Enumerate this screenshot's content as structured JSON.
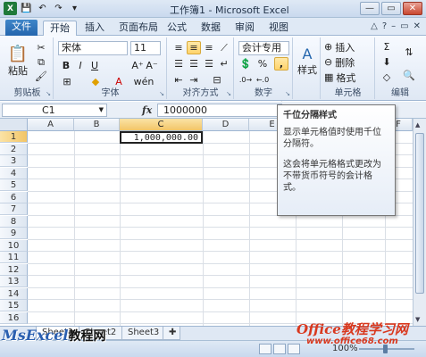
{
  "window": {
    "title": "工作簿1 - Microsoft Excel",
    "buttons": {
      "minimize": "—",
      "restore": "▭",
      "close": "✕"
    }
  },
  "quick_access": {
    "app_icon": "X",
    "icons": [
      "save-icon",
      "undo-icon",
      "redo-icon",
      "customize-icon"
    ]
  },
  "ribbon_tabs": [
    {
      "label": "文件"
    },
    {
      "label": "开始"
    },
    {
      "label": "插入"
    },
    {
      "label": "页面布局"
    },
    {
      "label": "公式"
    },
    {
      "label": "数据"
    },
    {
      "label": "审阅"
    },
    {
      "label": "视图"
    }
  ],
  "ribbon": {
    "clipboard": {
      "paste": "粘贴",
      "group": "剪贴板"
    },
    "font": {
      "name": "宋体",
      "size": "11",
      "bold": "B",
      "italic": "I",
      "underline": "U",
      "group": "字体"
    },
    "alignment": {
      "group": "对齐方式"
    },
    "number": {
      "format": "会计专用",
      "percent": "%",
      "comma": ",",
      "group": "数字"
    },
    "styles": {
      "label": "样式"
    },
    "cells": {
      "insert": "插入",
      "delete": "删除",
      "format": "格式",
      "group": "单元格"
    },
    "editing": {
      "group": "编辑"
    }
  },
  "formula_bar": {
    "name_box": "C1",
    "fx": "fx",
    "value": "1000000"
  },
  "grid": {
    "columns": [
      "A",
      "B",
      "C",
      "D",
      "E",
      "F"
    ],
    "rows": [
      "1",
      "2",
      "3",
      "4",
      "5",
      "6",
      "7",
      "8",
      "9",
      "10",
      "11",
      "12",
      "13",
      "14",
      "15",
      "16"
    ],
    "cell_C1": "1,000,000.00",
    "selected_column": "C",
    "selected_row": "1"
  },
  "tooltip": {
    "title": "千位分隔样式",
    "line1": "显示单元格值时使用千位分隔符。",
    "line2": "这会将单元格格式更改为不带货币符号的会计格式。"
  },
  "sheet_tabs": [
    "Sheet1",
    "Sheet2",
    "Sheet3"
  ],
  "status": {
    "zoom": "100%"
  },
  "watermarks": {
    "left_en": "MsExcel",
    "left_cn": "教程网",
    "right_line1": "Office教程学习网",
    "right_line2": "www.office68.com"
  },
  "colors": {
    "file_tab": "#2466ad",
    "selection_highlight": "#f2c567",
    "watermark_red": "#d9381e",
    "watermark_blue": "#2a5fb0"
  }
}
